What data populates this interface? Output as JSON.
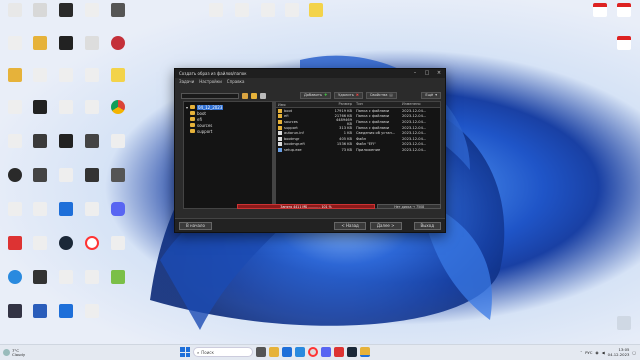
{
  "dialog": {
    "title": "Создать образ из файлов/папок",
    "menu": [
      "Задачи",
      "Настройки",
      "Справка"
    ],
    "toolbar": {
      "add": "Добавить",
      "remove": "Удалить",
      "properties": "Свойства",
      "more": "Ещё"
    },
    "tree": {
      "root": "04_12_2023",
      "children": [
        "boot",
        "efi",
        "sources",
        "support"
      ]
    },
    "columns": [
      "Имя",
      "Размер",
      "Тип",
      "Изменено"
    ],
    "files": [
      {
        "name": "boot",
        "size": "17919 KB",
        "type": "Папка с файлами",
        "modified": "2023-12-04...",
        "kind": "folder"
      },
      {
        "name": "efi",
        "size": "21766 KB",
        "type": "Папка с файлами",
        "modified": "2023-12-04...",
        "kind": "folder"
      },
      {
        "name": "sources",
        "size": "4489469 KB",
        "type": "Папка с файлами",
        "modified": "2023-12-04...",
        "kind": "folder"
      },
      {
        "name": "support",
        "size": "313 KB",
        "type": "Папка с файлами",
        "modified": "2023-12-04...",
        "kind": "folder"
      },
      {
        "name": "autorun.inf",
        "size": "1 KB",
        "type": "Сведения об устан...",
        "modified": "2023-12-04...",
        "kind": "file"
      },
      {
        "name": "bootmgr",
        "size": "405 KB",
        "type": "Файл",
        "modified": "2023-12-04...",
        "kind": "file"
      },
      {
        "name": "bootmgr.efi",
        "size": "1536 KB",
        "type": "Файл \"EFI\"",
        "modified": "2023-12-04...",
        "kind": "file"
      },
      {
        "name": "setup.exe",
        "size": "73 KB",
        "type": "Приложение",
        "modified": "2023-12-04...",
        "kind": "exe"
      }
    ],
    "status": {
      "progress_label": "Занято 4411 МБ ............ 101 %",
      "right_label": "Нет диска → 7508"
    },
    "buttons": {
      "start": "В начало",
      "back": "< Назад",
      "next": "Далее >",
      "exit": "Выход"
    }
  },
  "taskbar": {
    "weather_temp": "7°C",
    "weather_desc": "Cloudy",
    "search_placeholder": "Поиск",
    "lang": "РУС",
    "time": "13:05",
    "date": "04.12.2023"
  },
  "colors": {
    "accent": "#2f6fd1",
    "progress": "#8b1a1a",
    "folder": "#e6b23a"
  }
}
